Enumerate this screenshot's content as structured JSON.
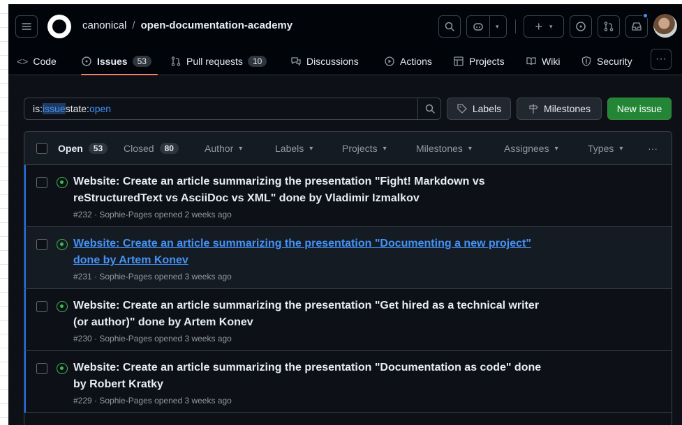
{
  "repo": {
    "owner": "canonical",
    "separator": "/",
    "name": "open-documentation-academy"
  },
  "tabs": [
    {
      "label": "Code",
      "icon": "code-icon"
    },
    {
      "label": "Issues",
      "count": "53",
      "icon": "issue-opened-icon"
    },
    {
      "label": "Pull requests",
      "count": "10",
      "icon": "git-pull-request-icon"
    },
    {
      "label": "Discussions",
      "icon": "comment-discussion-icon"
    },
    {
      "label": "Actions",
      "icon": "play-icon"
    },
    {
      "label": "Projects",
      "icon": "table-icon"
    },
    {
      "label": "Wiki",
      "icon": "book-icon"
    },
    {
      "label": "Security",
      "icon": "shield-icon"
    }
  ],
  "filter": {
    "key1": "is:",
    "val1": "issue",
    "key2": " state:",
    "val2": "open"
  },
  "buttons": {
    "labels": "Labels",
    "milestones": "Milestones",
    "new_issue": "New issue"
  },
  "list_header": {
    "open_label": "Open",
    "open_count": "53",
    "closed_label": "Closed",
    "closed_count": "80",
    "author": "Author",
    "labels": "Labels",
    "projects": "Projects",
    "milestones": "Milestones",
    "assignees": "Assignees",
    "types": "Types"
  },
  "issues": [
    {
      "title": "Website: Create an article summarizing the presentation \"Fight! Markdown vs reStructuredText vs AsciiDoc vs XML\" done by Vladimir Izmalkov",
      "meta": "#232 · Sophie-Pages opened 2 weeks ago"
    },
    {
      "title": "Website: Create an article summarizing the presentation \"Documenting a new project\" done by Artem Konev",
      "meta": "#231 · Sophie-Pages opened 3 weeks ago"
    },
    {
      "title": "Website: Create an article summarizing the presentation \"Get hired as a technical writer (or author)\" done by Artem Konev",
      "meta": "#230 · Sophie-Pages opened 3 weeks ago"
    },
    {
      "title": "Website: Create an article summarizing the presentation \"Documentation as code\" done by Robert Kratky",
      "meta": "#229 · Sophie-Pages opened 3 weeks ago"
    }
  ],
  "colors": {
    "accent": "#4493f8",
    "open_green": "#3fb950",
    "primary_button": "#238636",
    "tab_underline": "#f78166"
  }
}
